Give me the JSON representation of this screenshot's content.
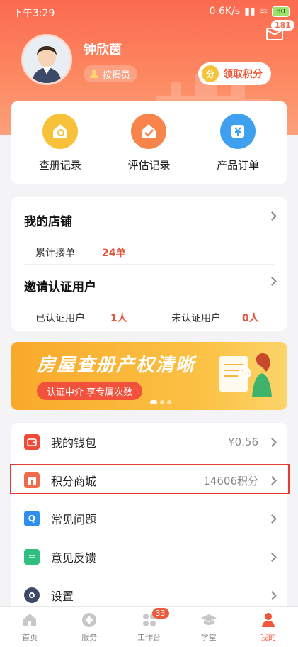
{
  "status_bar": {
    "time": "下午3:29",
    "speed": "0.6K/s",
    "battery": "80"
  },
  "header": {
    "message_badge": "181",
    "user_name": "钟欣茵",
    "role": "按揭员",
    "points_button": "领取积分"
  },
  "quick_actions": [
    {
      "label": "查册记录",
      "icon": "house-search-icon",
      "color": "#f7c23a"
    },
    {
      "label": "评估记录",
      "icon": "check-house-icon",
      "color": "#f7844a"
    },
    {
      "label": "产品订单",
      "icon": "yuan-order-icon",
      "color": "#3fa0f0"
    }
  ],
  "store": {
    "title": "我的店铺",
    "total_orders_label": "累计接单",
    "total_orders_value": "24单",
    "invite_title": "邀请认证用户",
    "certified_label": "已认证用户",
    "certified_value": "1人",
    "uncertified_label": "未认证用户",
    "uncertified_value": "0人"
  },
  "banner": {
    "title": "房屋查册产权清晰",
    "pill": "认证中介 享专属次数"
  },
  "menu": [
    {
      "label": "我的钱包",
      "value": "¥0.56",
      "icon": "wallet-icon",
      "color": "#f04a3b"
    },
    {
      "label": "积分商城",
      "value": "14606积分",
      "icon": "gift-icon",
      "color": "#f26a4c"
    },
    {
      "label": "常见问题",
      "value": "",
      "icon": "question-icon",
      "color": "#2f8ef0"
    },
    {
      "label": "意见反馈",
      "value": "",
      "icon": "feedback-icon",
      "color": "#2fbf7f"
    },
    {
      "label": "设置",
      "value": "",
      "icon": "settings-gear-icon",
      "color": "#3e4a66"
    }
  ],
  "tabs": [
    {
      "label": "首页",
      "icon": "home-icon"
    },
    {
      "label": "服务",
      "icon": "service-icon"
    },
    {
      "label": "工作台",
      "icon": "workbench-icon",
      "badge": "33"
    },
    {
      "label": "学堂",
      "icon": "graduation-cap-icon"
    },
    {
      "label": "我的",
      "icon": "person-icon",
      "active": true
    }
  ]
}
